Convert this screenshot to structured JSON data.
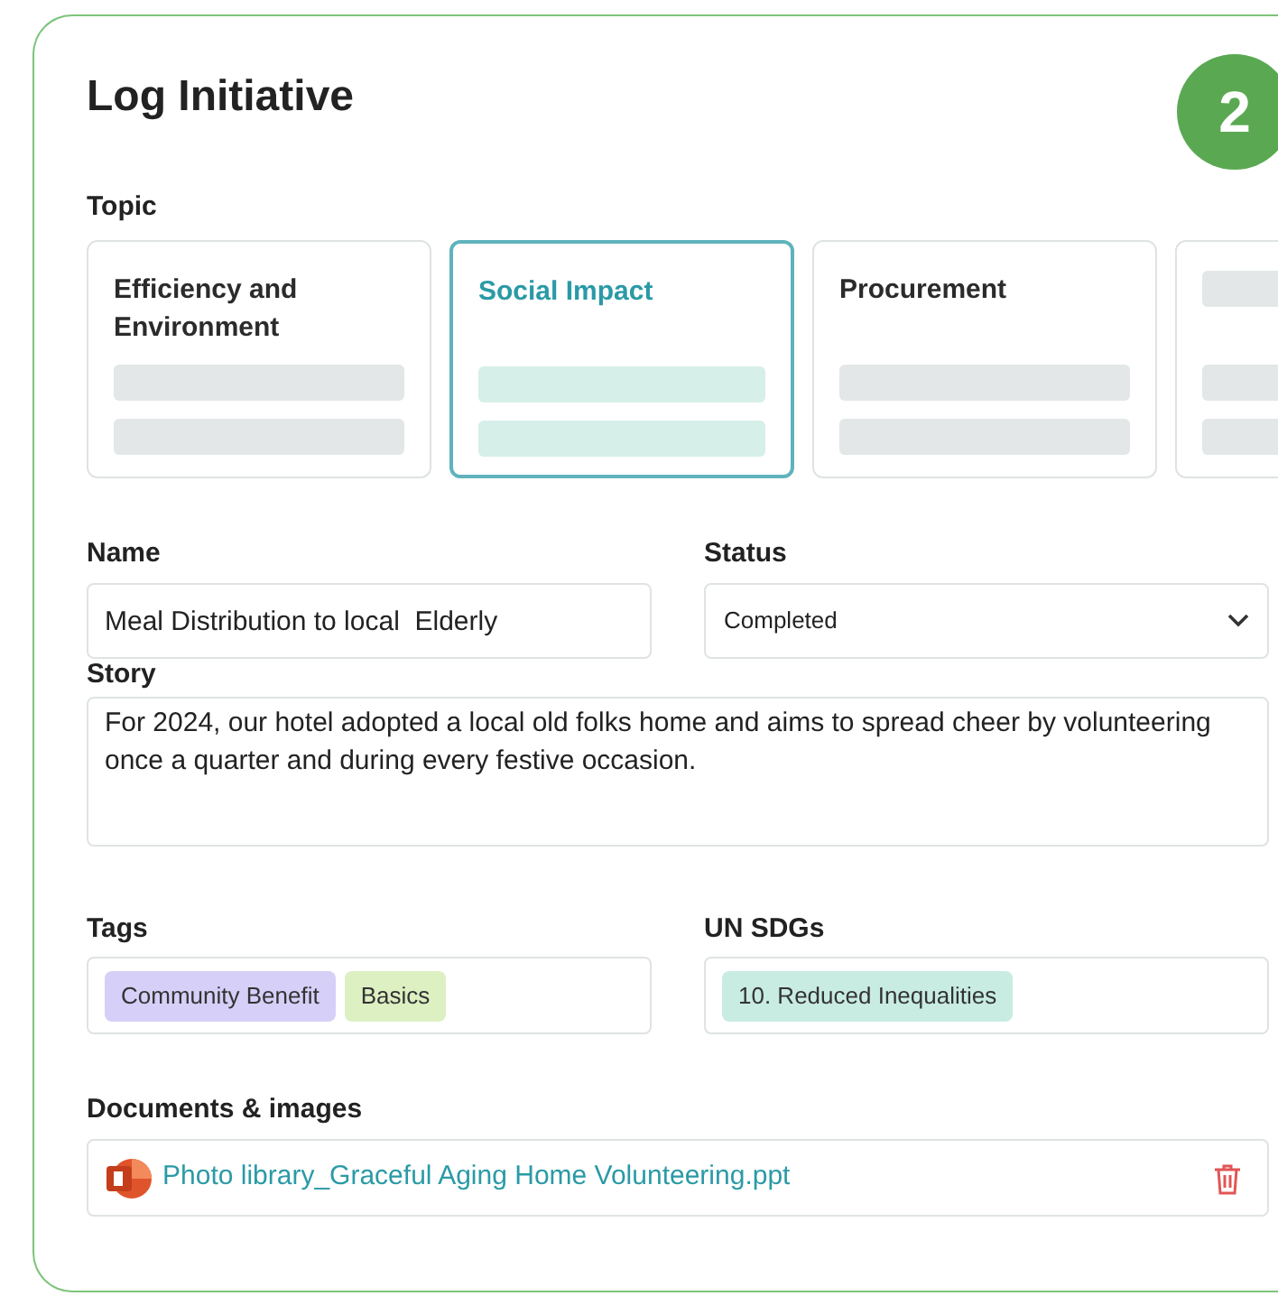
{
  "title": "Log Initiative",
  "step": "2",
  "topic": {
    "label": "Topic",
    "options": [
      {
        "label": "Efficiency and Environment",
        "selected": false
      },
      {
        "label": "Social Impact",
        "selected": true
      },
      {
        "label": "Procurement",
        "selected": false
      },
      {
        "selected": false
      }
    ]
  },
  "name": {
    "label": "Name",
    "value": "Meal Distribution to local  Elderly"
  },
  "status": {
    "label": "Status",
    "value": "Completed"
  },
  "story": {
    "label": "Story",
    "value": "For 2024, our hotel adopted a local old folks home and aims to spread cheer by volunteering once a quarter and during every festive occasion."
  },
  "tags": {
    "label": "Tags",
    "items": [
      {
        "label": "Community Benefit",
        "color": "#d6cff8"
      },
      {
        "label": "Basics",
        "color": "#ddf0c2"
      }
    ]
  },
  "sdgs": {
    "label": "UN SDGs",
    "items": [
      {
        "label": "10. Reduced Inequalities",
        "color": "#c8ece2"
      }
    ]
  },
  "documents": {
    "label": "Documents & images",
    "files": [
      {
        "name": "Photo library_Graceful Aging Home Volunteering.ppt"
      }
    ]
  }
}
